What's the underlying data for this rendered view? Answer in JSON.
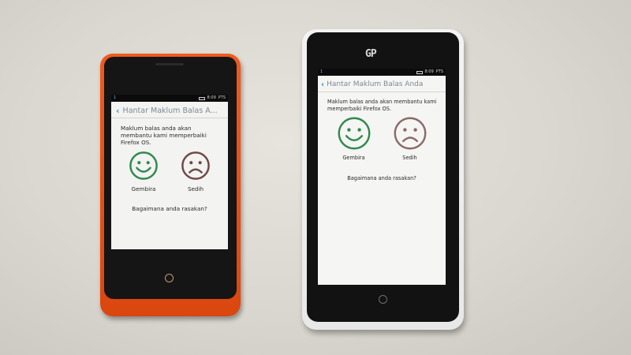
{
  "status_bar": {
    "time": "8:09",
    "indicator": "1",
    "network": "PTS"
  },
  "screen": {
    "back_icon": "chevron-left-icon",
    "title": "Hantar Maklum Balas Anda",
    "title_truncated": "Hantar Maklum Balas A...",
    "message": "Maklum balas anda akan membantu kami memperbaiki Firefox OS.",
    "happy": {
      "icon": "smiley-happy-icon",
      "label": "Gembira",
      "color": "#2e8a4e"
    },
    "sad": {
      "icon": "smiley-sad-icon",
      "label": "Sedih",
      "color": "#8a6a67"
    },
    "question": "Bagaimana anda rasakan?"
  },
  "devices": {
    "left": {
      "body_color": "#e44d12"
    },
    "right": {
      "body_color": "#ececec",
      "brand_mark": "GP"
    }
  }
}
